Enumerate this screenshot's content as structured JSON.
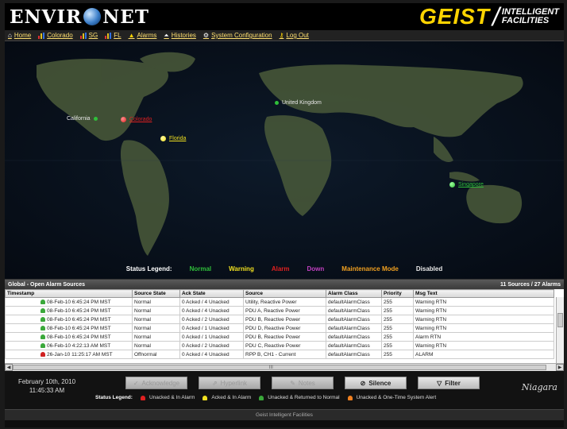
{
  "header": {
    "logo_left": "ENVIR",
    "logo_right": "NET",
    "brand": "GEIST",
    "tagline_1": "INTELLIGENT",
    "tagline_2": "FACILITIES"
  },
  "nav": {
    "items": [
      {
        "label": "Home",
        "icon": "home-icon"
      },
      {
        "label": "Colorado",
        "icon": "bars-icon"
      },
      {
        "label": "SG",
        "icon": "bars-icon"
      },
      {
        "label": "FL",
        "icon": "bars-icon"
      },
      {
        "label": "Alarms",
        "icon": "bell-icon"
      },
      {
        "label": "Histories",
        "icon": "chart-icon"
      },
      {
        "label": "System Configuration",
        "icon": "gear-icon"
      },
      {
        "label": "Log Out",
        "icon": "key-icon"
      }
    ]
  },
  "map": {
    "sites": [
      {
        "label": "California",
        "color": "#2fbf3a",
        "text_color": "#e8e8e8",
        "underline": false
      },
      {
        "label": "Colorado",
        "color": "#e02020",
        "text_color": "#e02020",
        "underline": true
      },
      {
        "label": "Florida",
        "color": "#f0e020",
        "text_color": "#f0e020",
        "underline": true
      },
      {
        "label": "United Kingdom",
        "color": "#2fbf3a",
        "text_color": "#e8e8e8",
        "underline": false
      },
      {
        "label": "Singapore",
        "color": "#2fbf3a",
        "text_color": "#2fbf3a",
        "underline": true
      }
    ],
    "legend_title": "Status Legend:",
    "legend": [
      {
        "label": "Normal",
        "color": "#2fbf3a"
      },
      {
        "label": "Warning",
        "color": "#f0e020"
      },
      {
        "label": "Alarm",
        "color": "#e02020"
      },
      {
        "label": "Down",
        "color": "#c040c0"
      },
      {
        "label": "Maintenance Mode",
        "color": "#f0a020"
      },
      {
        "label": "Disabled",
        "color": "#e8e8e8"
      }
    ]
  },
  "alarms": {
    "title": "Global - Open Alarm Sources",
    "summary": "11 Sources / 27 Alarms",
    "columns": [
      "Timestamp",
      "Source State",
      "Ack State",
      "Source",
      "Alarm Class",
      "Priority",
      "Msg Text"
    ],
    "rows": [
      {
        "bell": "#3aa83a",
        "ts": "08-Feb-10 6:45:24 PM MST",
        "state": "Normal",
        "ack": "0 Acked / 4 Unacked",
        "source": "Utility, Reactive Power",
        "cls": "defaultAlarmClass",
        "pri": "255",
        "msg": "Warning RTN"
      },
      {
        "bell": "#3aa83a",
        "ts": "08-Feb-10 6:45:24 PM MST",
        "state": "Normal",
        "ack": "0 Acked / 4 Unacked",
        "source": "PDU A, Reactive Power",
        "cls": "defaultAlarmClass",
        "pri": "255",
        "msg": "Warning RTN"
      },
      {
        "bell": "#3aa83a",
        "ts": "08-Feb-10 6:45:24 PM MST",
        "state": "Normal",
        "ack": "0 Acked / 2 Unacked",
        "source": "PDU B, Reactive Power",
        "cls": "defaultAlarmClass",
        "pri": "255",
        "msg": "Warning RTN"
      },
      {
        "bell": "#3aa83a",
        "ts": "08-Feb-10 6:45:24 PM MST",
        "state": "Normal",
        "ack": "0 Acked / 1 Unacked",
        "source": "PDU D, Reactive Power",
        "cls": "defaultAlarmClass",
        "pri": "255",
        "msg": "Warning RTN"
      },
      {
        "bell": "#3aa83a",
        "ts": "08-Feb-10 6:45:24 PM MST",
        "state": "Normal",
        "ack": "0 Acked / 1 Unacked",
        "source": "PDU B, Reactive Power",
        "cls": "defaultAlarmClass",
        "pri": "255",
        "msg": "Alarm RTN"
      },
      {
        "bell": "#3aa83a",
        "ts": "06-Feb-10 4:22:13 AM MST",
        "state": "Normal",
        "ack": "0 Acked / 2 Unacked",
        "source": "PDU C, Reactive Power",
        "cls": "defaultAlarmClass",
        "pri": "255",
        "msg": "Warning RTN"
      },
      {
        "bell": "#d02020",
        "ts": "26-Jan-10 11:25:17 AM MST",
        "state": "Offnormal",
        "ack": "0 Acked / 4 Unacked",
        "source": "RPP B, CH1 - Current",
        "cls": "defaultAlarmClass",
        "pri": "255",
        "msg": "ALARM"
      }
    ],
    "hscroll_center": "III"
  },
  "bottom": {
    "date": "February 10th, 2010",
    "time": "11:45:33 AM",
    "buttons": {
      "acknowledge": "Acknowledge",
      "hyperlink": "Hyperlink",
      "notes": "Notes",
      "silence": "Silence",
      "filter": "Filter"
    },
    "legend_title": "Status Legend:",
    "legend": [
      {
        "label": "Unacked & In Alarm",
        "color": "#e02020"
      },
      {
        "label": "Acked & In Alarm",
        "color": "#f0e020"
      },
      {
        "label": "Unacked & Returned to Normal",
        "color": "#3aa83a"
      },
      {
        "label": "Unacked & One-Time System Alert",
        "color": "#f08020"
      }
    ],
    "vendor": "Niagara"
  },
  "footer": {
    "text": "Geist Intelligent Facilities"
  }
}
